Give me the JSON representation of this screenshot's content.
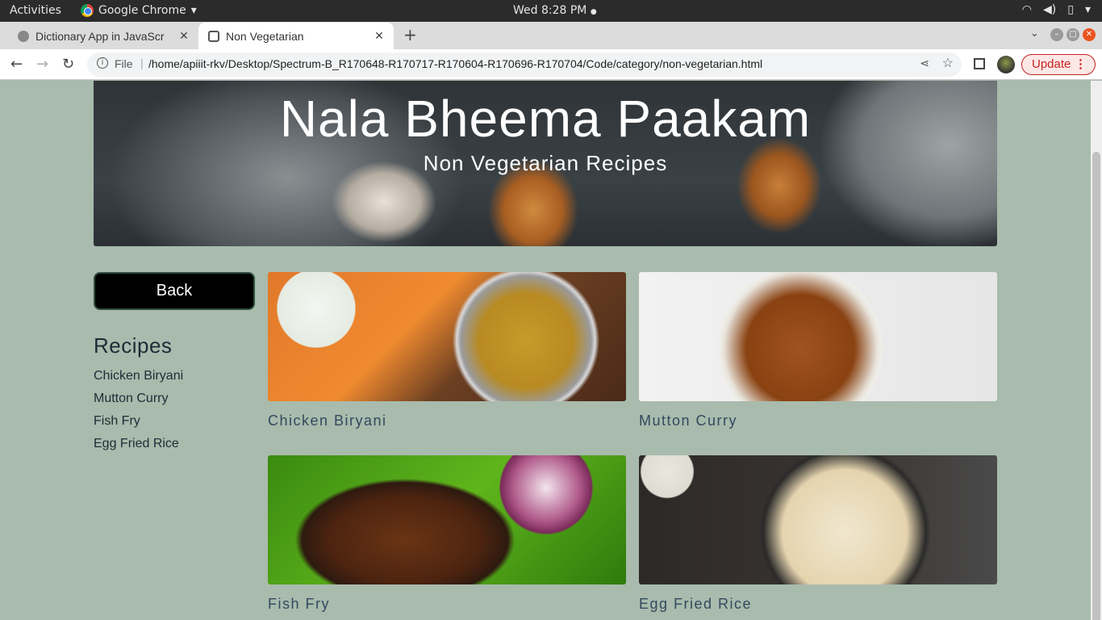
{
  "system_bar": {
    "activities": "Activities",
    "app_name": "Google Chrome",
    "clock": "Wed  8:28 PM",
    "dot": "●"
  },
  "browser": {
    "tabs": [
      {
        "title": "Dictionary App in JavaScr",
        "active": false
      },
      {
        "title": "Non Vegetarian",
        "active": true
      }
    ],
    "new_tab": "+",
    "address": {
      "scheme_label": "File",
      "url": "/home/apiiit-rkv/Desktop/Spectrum-B_R170648-R170717-R170604-R170696-R170704/Code/category/non-vegetarian.html"
    },
    "update_label": "Update"
  },
  "page": {
    "hero": {
      "title": "Nala Bheema Paakam",
      "subtitle": "Non Vegetarian Recipes"
    },
    "back_label": "Back",
    "sidebar": {
      "heading": "Recipes",
      "links": [
        "Chicken Biryani",
        "Mutton Curry",
        "Fish Fry",
        "Egg Fried Rice"
      ]
    },
    "cards": [
      {
        "title": "Chicken Biryani"
      },
      {
        "title": "Mutton Curry"
      },
      {
        "title": "Fish Fry"
      },
      {
        "title": "Egg Fried Rice"
      }
    ]
  }
}
